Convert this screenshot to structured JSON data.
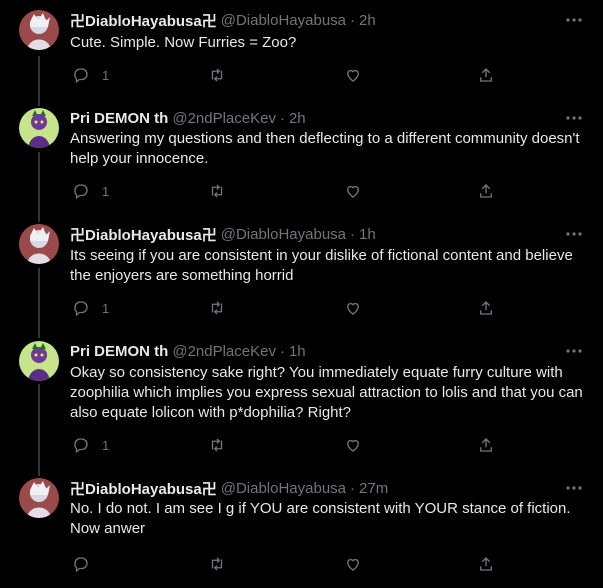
{
  "tweets": [
    {
      "name": "卍DiabloHayabusa卍",
      "handle": "@DiabloHayabusa",
      "sep": "·",
      "time": "2h",
      "text": "Cute. Simple. Now Furries = Zoo?",
      "replies": "1",
      "avatar": "anime"
    },
    {
      "name": "Pri DEMON th",
      "handle": "@2ndPlaceKev",
      "sep": "·",
      "time": "2h",
      "text": "Answering my questions and then deflecting to a different community doesn't help your innocence.",
      "replies": "1",
      "avatar": "purple"
    },
    {
      "name": "卍DiabloHayabusa卍",
      "handle": "@DiabloHayabusa",
      "sep": "·",
      "time": "1h",
      "text": "Its seeing if you are consistent in your dislike of fictional content and believe the enjoyers are something horrid",
      "replies": "1",
      "avatar": "anime"
    },
    {
      "name": "Pri DEMON th",
      "handle": "@2ndPlaceKev",
      "sep": "·",
      "time": "1h",
      "text": "Okay so consistency sake right? You immediately equate furry culture with zoophilia which implies you express sexual attraction to lolis and that you can also equate lolicon with p*dophilia? Right?",
      "replies": "1",
      "avatar": "purple"
    },
    {
      "name": "卍DiabloHayabusa卍",
      "handle": "@DiabloHayabusa",
      "sep": "·",
      "time": "27m",
      "text": "No. I do not. I am see I g if YOU are consistent with YOUR stance of fiction. Now anwer",
      "replies": "",
      "avatar": "anime"
    }
  ],
  "colors": {
    "background": "#000000",
    "text": "#e7e9ea",
    "muted": "#71767b",
    "rail": "#333639"
  },
  "icons": {
    "reply": "reply-icon",
    "retweet": "retweet-icon",
    "like": "like-icon",
    "share": "share-icon",
    "more": "more-icon"
  }
}
